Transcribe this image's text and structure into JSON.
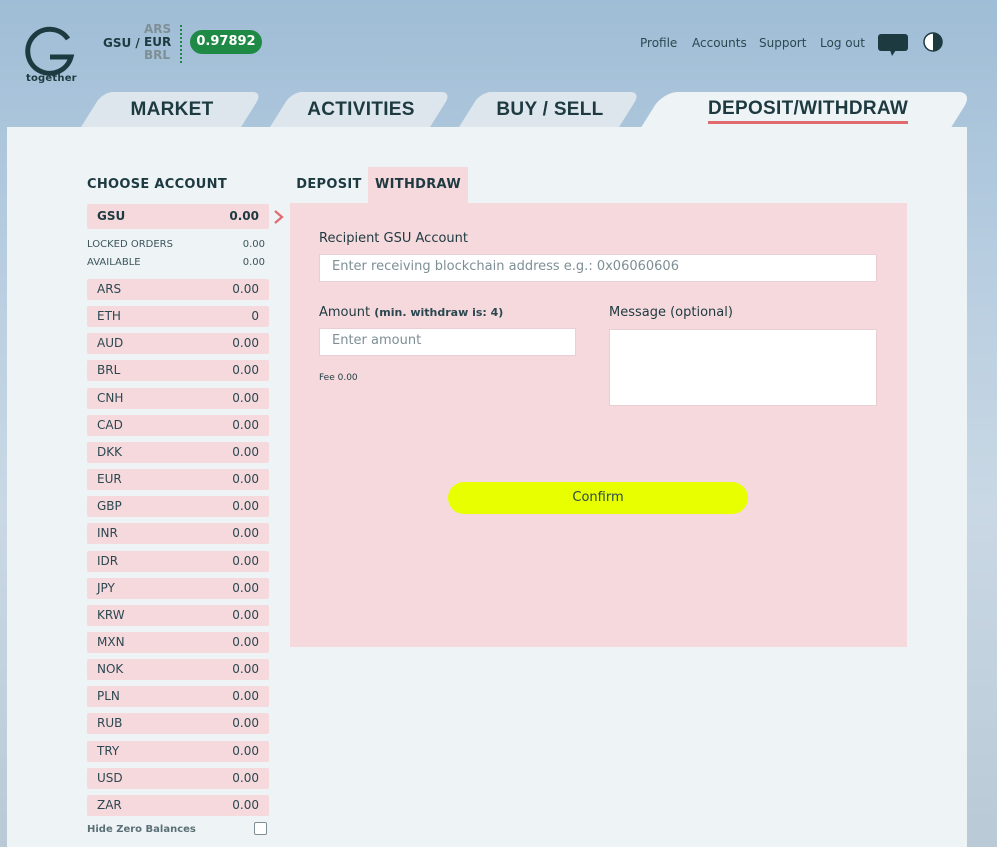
{
  "brand": {
    "word": "together"
  },
  "pair": {
    "base": "GSU /",
    "quotes": [
      "ARS",
      "EUR",
      "BRL"
    ],
    "active_quote": "EUR",
    "price": "0.97892"
  },
  "nav": {
    "profile": "Profile",
    "accounts": "Accounts",
    "support": "Support",
    "logout": "Log out"
  },
  "icons": {
    "chat": "chat-bubble-icon",
    "contrast": "contrast-toggle-icon",
    "arrow": "chevron-right-icon"
  },
  "colors": {
    "accent_green": "#1f8a45",
    "form_pink": "#f5d9dd",
    "confirm_yellow": "#e8ff00",
    "tab_underline": "#e06a6d"
  },
  "tabs": [
    "MARKET",
    "ACTIVITIES",
    "BUY / SELL",
    "DEPOSIT/WITHDRAW"
  ],
  "active_tab": "DEPOSIT/WITHDRAW",
  "accounts_panel": {
    "title": "CHOOSE ACCOUNT",
    "selected": {
      "name": "GSU",
      "value": "0.00"
    },
    "locked_label": "LOCKED ORDERS",
    "locked_value": "0.00",
    "available_label": "AVAILABLE",
    "available_value": "0.00",
    "rows": [
      {
        "name": "ARS",
        "value": "0.00"
      },
      {
        "name": "ETH",
        "value": "0"
      },
      {
        "name": "AUD",
        "value": "0.00"
      },
      {
        "name": "BRL",
        "value": "0.00"
      },
      {
        "name": "CNH",
        "value": "0.00"
      },
      {
        "name": "CAD",
        "value": "0.00"
      },
      {
        "name": "DKK",
        "value": "0.00"
      },
      {
        "name": "EUR",
        "value": "0.00"
      },
      {
        "name": "GBP",
        "value": "0.00"
      },
      {
        "name": "INR",
        "value": "0.00"
      },
      {
        "name": "IDR",
        "value": "0.00"
      },
      {
        "name": "JPY",
        "value": "0.00"
      },
      {
        "name": "KRW",
        "value": "0.00"
      },
      {
        "name": "MXN",
        "value": "0.00"
      },
      {
        "name": "NOK",
        "value": "0.00"
      },
      {
        "name": "PLN",
        "value": "0.00"
      },
      {
        "name": "RUB",
        "value": "0.00"
      },
      {
        "name": "TRY",
        "value": "0.00"
      },
      {
        "name": "USD",
        "value": "0.00"
      },
      {
        "name": "ZAR",
        "value": "0.00"
      }
    ],
    "hide_zero_label": "Hide Zero Balances",
    "hide_zero_checked": false
  },
  "subtabs": {
    "deposit": "DEPOSIT",
    "withdraw": "WITHDRAW",
    "active": "WITHDRAW"
  },
  "form": {
    "recipient_label": "Recipient GSU Account",
    "recipient_placeholder": "Enter receiving blockchain address e.g.: 0x06060606",
    "amount_label": "Amount",
    "amount_hint": "(min. withdraw is: 4)",
    "amount_placeholder": "Enter amount",
    "fee_text": "Fee 0.00",
    "message_label": "Message (optional)",
    "message_value": "",
    "confirm_label": "Confirm"
  }
}
